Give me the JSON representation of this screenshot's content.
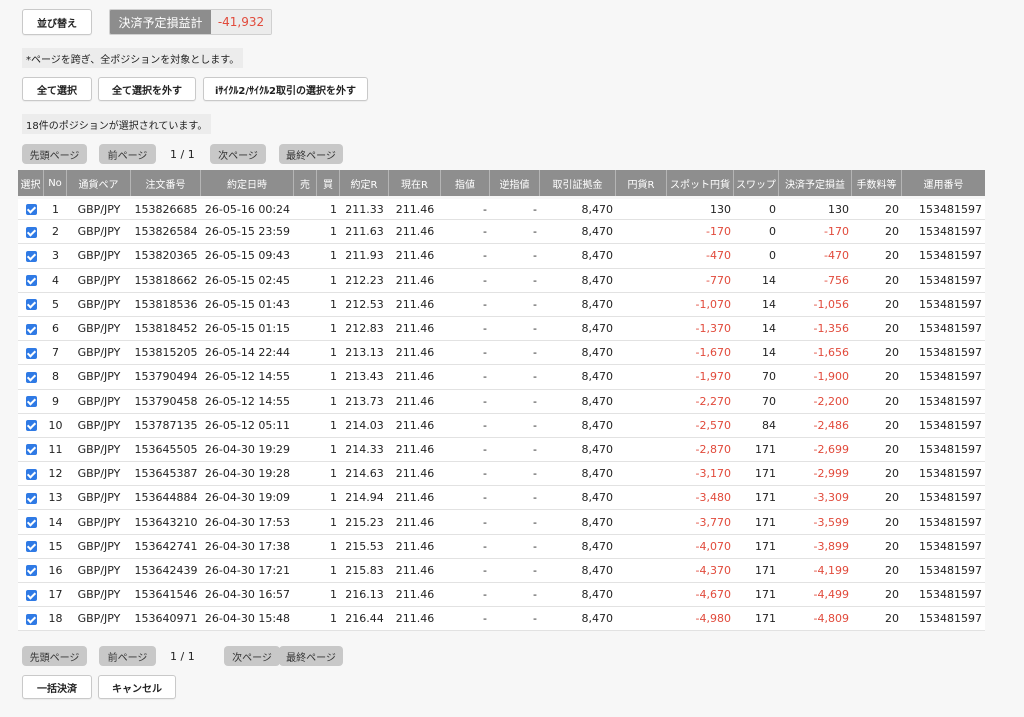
{
  "toolbar": {
    "sort_label": "並び替え"
  },
  "total": {
    "label": "決済予定損益計",
    "value": "-41,932",
    "value_color": "#e14a3b"
  },
  "note": "*ページを跨ぎ、全ポジションを対象とします。",
  "selection_buttons": {
    "select_all": "全て選択",
    "deselect_all": "全て選択を外す",
    "deselect_cycle": "iｻｲｸﾙ2/ｻｲｸﾙ2取引の選択を外す"
  },
  "selected_count_text": "18件のポジションが選択されています。",
  "pagination": {
    "first": "先頭ページ",
    "prev": "前ページ",
    "page_info": "1 / 1",
    "next": "次ページ",
    "last": "最終ページ"
  },
  "table": {
    "headers": [
      "選択",
      "No",
      "通貨ペア",
      "注文番号",
      "約定日時",
      "売",
      "買",
      "約定R",
      "現在R",
      "指値",
      "逆指値",
      "取引証拠金",
      "円貨R",
      "スポット円貨",
      "スワップ",
      "決済予定損益",
      "手数料等",
      "運用番号"
    ],
    "rows": [
      {
        "no": "1",
        "pair": "GBP/JPY",
        "order": "153826685",
        "date": "26-05-16 00:24",
        "sell": "",
        "buy": "1",
        "exec": "211.33",
        "cur": "211.46",
        "limit": "-",
        "stop": "-",
        "margin": "8,470",
        "yen": "",
        "spot": "130",
        "swap": "0",
        "pl": "130",
        "fee": "20",
        "op": "153481597"
      },
      {
        "no": "2",
        "pair": "GBP/JPY",
        "order": "153826584",
        "date": "26-05-15 23:59",
        "sell": "",
        "buy": "1",
        "exec": "211.63",
        "cur": "211.46",
        "limit": "-",
        "stop": "-",
        "margin": "8,470",
        "yen": "",
        "spot": "-170",
        "swap": "0",
        "pl": "-170",
        "fee": "20",
        "op": "153481597"
      },
      {
        "no": "3",
        "pair": "GBP/JPY",
        "order": "153820365",
        "date": "26-05-15 09:43",
        "sell": "",
        "buy": "1",
        "exec": "211.93",
        "cur": "211.46",
        "limit": "-",
        "stop": "-",
        "margin": "8,470",
        "yen": "",
        "spot": "-470",
        "swap": "0",
        "pl": "-470",
        "fee": "20",
        "op": "153481597"
      },
      {
        "no": "4",
        "pair": "GBP/JPY",
        "order": "153818662",
        "date": "26-05-15 02:45",
        "sell": "",
        "buy": "1",
        "exec": "212.23",
        "cur": "211.46",
        "limit": "-",
        "stop": "-",
        "margin": "8,470",
        "yen": "",
        "spot": "-770",
        "swap": "14",
        "pl": "-756",
        "fee": "20",
        "op": "153481597"
      },
      {
        "no": "5",
        "pair": "GBP/JPY",
        "order": "153818536",
        "date": "26-05-15 01:43",
        "sell": "",
        "buy": "1",
        "exec": "212.53",
        "cur": "211.46",
        "limit": "-",
        "stop": "-",
        "margin": "8,470",
        "yen": "",
        "spot": "-1,070",
        "swap": "14",
        "pl": "-1,056",
        "fee": "20",
        "op": "153481597"
      },
      {
        "no": "6",
        "pair": "GBP/JPY",
        "order": "153818452",
        "date": "26-05-15 01:15",
        "sell": "",
        "buy": "1",
        "exec": "212.83",
        "cur": "211.46",
        "limit": "-",
        "stop": "-",
        "margin": "8,470",
        "yen": "",
        "spot": "-1,370",
        "swap": "14",
        "pl": "-1,356",
        "fee": "20",
        "op": "153481597"
      },
      {
        "no": "7",
        "pair": "GBP/JPY",
        "order": "153815205",
        "date": "26-05-14 22:44",
        "sell": "",
        "buy": "1",
        "exec": "213.13",
        "cur": "211.46",
        "limit": "-",
        "stop": "-",
        "margin": "8,470",
        "yen": "",
        "spot": "-1,670",
        "swap": "14",
        "pl": "-1,656",
        "fee": "20",
        "op": "153481597"
      },
      {
        "no": "8",
        "pair": "GBP/JPY",
        "order": "153790494",
        "date": "26-05-12 14:55",
        "sell": "",
        "buy": "1",
        "exec": "213.43",
        "cur": "211.46",
        "limit": "-",
        "stop": "-",
        "margin": "8,470",
        "yen": "",
        "spot": "-1,970",
        "swap": "70",
        "pl": "-1,900",
        "fee": "20",
        "op": "153481597"
      },
      {
        "no": "9",
        "pair": "GBP/JPY",
        "order": "153790458",
        "date": "26-05-12 14:55",
        "sell": "",
        "buy": "1",
        "exec": "213.73",
        "cur": "211.46",
        "limit": "-",
        "stop": "-",
        "margin": "8,470",
        "yen": "",
        "spot": "-2,270",
        "swap": "70",
        "pl": "-2,200",
        "fee": "20",
        "op": "153481597"
      },
      {
        "no": "10",
        "pair": "GBP/JPY",
        "order": "153787135",
        "date": "26-05-12 05:11",
        "sell": "",
        "buy": "1",
        "exec": "214.03",
        "cur": "211.46",
        "limit": "-",
        "stop": "-",
        "margin": "8,470",
        "yen": "",
        "spot": "-2,570",
        "swap": "84",
        "pl": "-2,486",
        "fee": "20",
        "op": "153481597"
      },
      {
        "no": "11",
        "pair": "GBP/JPY",
        "order": "153645505",
        "date": "26-04-30 19:29",
        "sell": "",
        "buy": "1",
        "exec": "214.33",
        "cur": "211.46",
        "limit": "-",
        "stop": "-",
        "margin": "8,470",
        "yen": "",
        "spot": "-2,870",
        "swap": "171",
        "pl": "-2,699",
        "fee": "20",
        "op": "153481597"
      },
      {
        "no": "12",
        "pair": "GBP/JPY",
        "order": "153645387",
        "date": "26-04-30 19:28",
        "sell": "",
        "buy": "1",
        "exec": "214.63",
        "cur": "211.46",
        "limit": "-",
        "stop": "-",
        "margin": "8,470",
        "yen": "",
        "spot": "-3,170",
        "swap": "171",
        "pl": "-2,999",
        "fee": "20",
        "op": "153481597"
      },
      {
        "no": "13",
        "pair": "GBP/JPY",
        "order": "153644884",
        "date": "26-04-30 19:09",
        "sell": "",
        "buy": "1",
        "exec": "214.94",
        "cur": "211.46",
        "limit": "-",
        "stop": "-",
        "margin": "8,470",
        "yen": "",
        "spot": "-3,480",
        "swap": "171",
        "pl": "-3,309",
        "fee": "20",
        "op": "153481597"
      },
      {
        "no": "14",
        "pair": "GBP/JPY",
        "order": "153643210",
        "date": "26-04-30 17:53",
        "sell": "",
        "buy": "1",
        "exec": "215.23",
        "cur": "211.46",
        "limit": "-",
        "stop": "-",
        "margin": "8,470",
        "yen": "",
        "spot": "-3,770",
        "swap": "171",
        "pl": "-3,599",
        "fee": "20",
        "op": "153481597"
      },
      {
        "no": "15",
        "pair": "GBP/JPY",
        "order": "153642741",
        "date": "26-04-30 17:38",
        "sell": "",
        "buy": "1",
        "exec": "215.53",
        "cur": "211.46",
        "limit": "-",
        "stop": "-",
        "margin": "8,470",
        "yen": "",
        "spot": "-4,070",
        "swap": "171",
        "pl": "-3,899",
        "fee": "20",
        "op": "153481597"
      },
      {
        "no": "16",
        "pair": "GBP/JPY",
        "order": "153642439",
        "date": "26-04-30 17:21",
        "sell": "",
        "buy": "1",
        "exec": "215.83",
        "cur": "211.46",
        "limit": "-",
        "stop": "-",
        "margin": "8,470",
        "yen": "",
        "spot": "-4,370",
        "swap": "171",
        "pl": "-4,199",
        "fee": "20",
        "op": "153481597"
      },
      {
        "no": "17",
        "pair": "GBP/JPY",
        "order": "153641546",
        "date": "26-04-30 16:57",
        "sell": "",
        "buy": "1",
        "exec": "216.13",
        "cur": "211.46",
        "limit": "-",
        "stop": "-",
        "margin": "8,470",
        "yen": "",
        "spot": "-4,670",
        "swap": "171",
        "pl": "-4,499",
        "fee": "20",
        "op": "153481597"
      },
      {
        "no": "18",
        "pair": "GBP/JPY",
        "order": "153640971",
        "date": "26-04-30 15:48",
        "sell": "",
        "buy": "1",
        "exec": "216.44",
        "cur": "211.46",
        "limit": "-",
        "stop": "-",
        "margin": "8,470",
        "yen": "",
        "spot": "-4,980",
        "swap": "171",
        "pl": "-4,809",
        "fee": "20",
        "op": "153481597"
      }
    ]
  },
  "footer": {
    "bulk_settle": "一括決済",
    "cancel": "キャンセル"
  },
  "colors": {
    "negative": "#e14a3b",
    "header_bg": "#8e8e8e",
    "checkbox": "#2f7ae5"
  }
}
